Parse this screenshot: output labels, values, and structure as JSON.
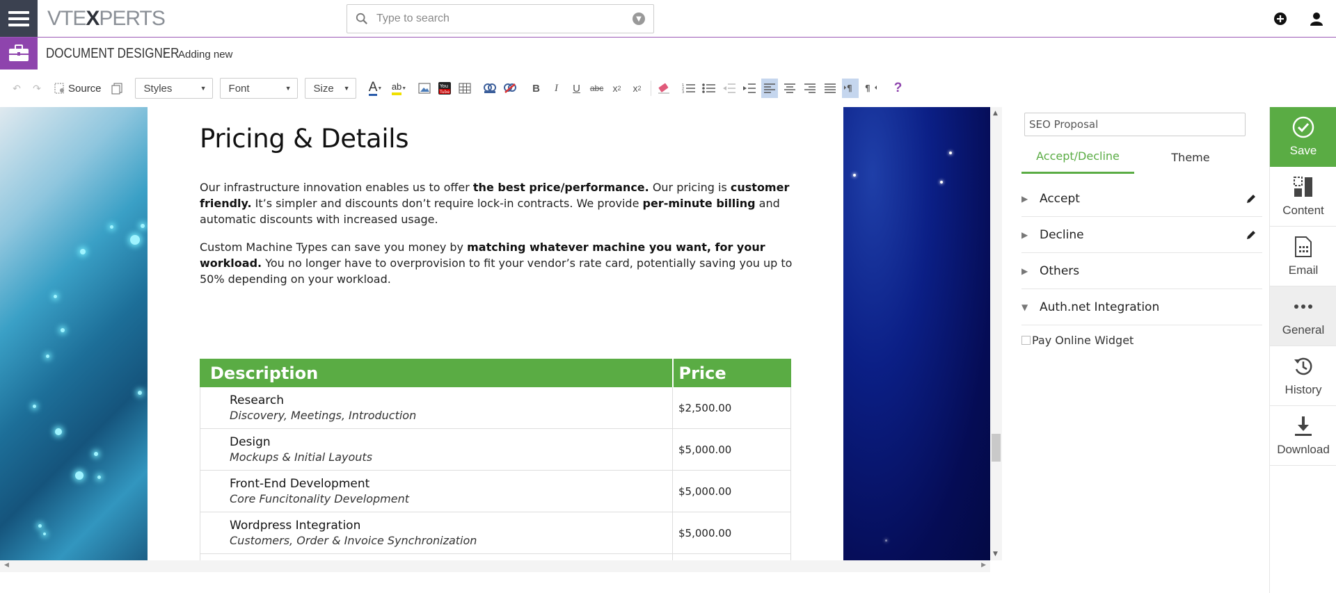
{
  "header": {
    "logo": {
      "pre": "VTE",
      "mid": "X",
      "post": "PERTS"
    },
    "search_placeholder": "Type to search"
  },
  "breadcrumb": {
    "module": "DOCUMENT DESIGNER",
    "page": "Adding new"
  },
  "toolbar": {
    "source_label": "Source",
    "styles_label": "Styles",
    "font_label": "Font",
    "size_label": "Size",
    "bold": "B",
    "italic": "I",
    "underline": "U",
    "strike": "abc",
    "help": "?"
  },
  "document": {
    "title": "Pricing & Details",
    "para1": [
      {
        "t": "Our infrastructure innovation enables us to offer ",
        "b": false
      },
      {
        "t": "the best price/performance.",
        "b": true
      },
      {
        "t": " Our pricing is ",
        "b": false
      },
      {
        "t": "customer friendly.",
        "b": true
      },
      {
        "t": " It’s simpler and discounts don’t require lock-in contracts. We provide ",
        "b": false
      },
      {
        "t": "per-minute billing",
        "b": true
      },
      {
        "t": " and automatic discounts with increased usage.",
        "b": false
      }
    ],
    "para2": [
      {
        "t": "Custom Machine Types can save you money by ",
        "b": false
      },
      {
        "t": "matching whatever machine you want, for your workload.",
        "b": true
      },
      {
        "t": " You no longer have to overprovision to fit your vendor’s rate card, potentially saving you up to 50% depending on your workload.",
        "b": false
      }
    ],
    "table": {
      "headers": {
        "description": "Description",
        "price": "Price"
      },
      "rows": [
        {
          "title": "Research",
          "subtitle": "Discovery, Meetings, Introduction",
          "price": "$2,500.00"
        },
        {
          "title": "Design",
          "subtitle": "Mockups & Initial Layouts",
          "price": "$5,000.00"
        },
        {
          "title": "Front-End Development",
          "subtitle": "Core Funcitonality Development",
          "price": "$5,000.00"
        },
        {
          "title": "Wordpress Integration",
          "subtitle": "Customers, Order & Invoice Synchronization",
          "price": "$5,000.00"
        }
      ]
    }
  },
  "panel": {
    "name_value": "SEO Proposal",
    "tabs": [
      {
        "label": "Accept/Decline",
        "selected": true
      },
      {
        "label": "Theme",
        "selected": false
      }
    ],
    "sections": [
      {
        "label": "Accept",
        "expanded": false,
        "editable": true
      },
      {
        "label": "Decline",
        "expanded": false,
        "editable": true
      },
      {
        "label": "Others",
        "expanded": false,
        "editable": false
      },
      {
        "label": "Auth.net Integration",
        "expanded": true,
        "editable": false
      }
    ],
    "widget_label": "Pay Online Widget"
  },
  "sidebar": {
    "save": "Save",
    "content": "Content",
    "email": "Email",
    "general": "General",
    "history": "History",
    "download": "Download"
  },
  "colors": {
    "accent_green": "#5aac44",
    "module_purple": "#8e44ad",
    "menu_dark": "#3b4150"
  }
}
